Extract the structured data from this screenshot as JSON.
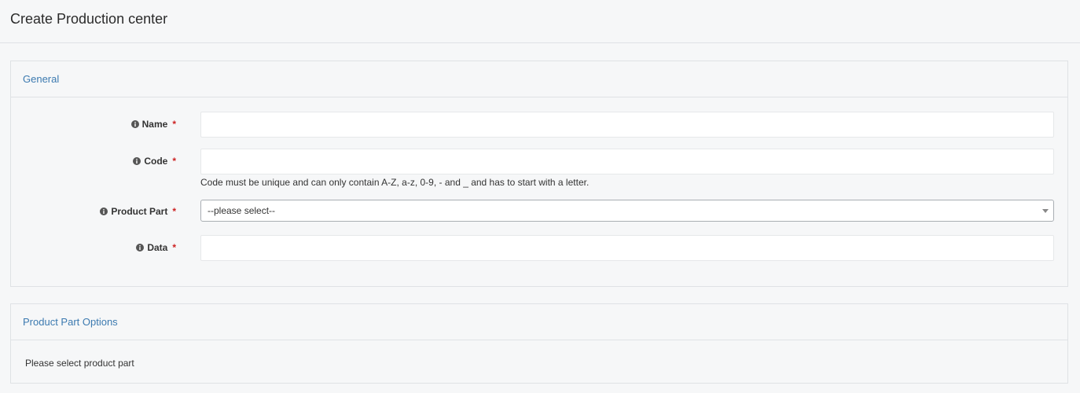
{
  "page": {
    "title": "Create Production center"
  },
  "general": {
    "heading": "General",
    "fields": {
      "name": {
        "label": "Name",
        "required": "*",
        "value": ""
      },
      "code": {
        "label": "Code",
        "required": "*",
        "value": "",
        "help": "Code must be unique and can only contain A-Z, a-z, 0-9, - and _ and has to start with a letter."
      },
      "product_part": {
        "label": "Product Part",
        "required": "*",
        "selected": "--please select--"
      },
      "data": {
        "label": "Data",
        "required": "*",
        "value": ""
      }
    }
  },
  "options": {
    "heading": "Product Part Options",
    "message": "Please select product part"
  },
  "colors": {
    "accent": "#3c7ab0",
    "required": "#cc2222",
    "background": "#f6f7f8",
    "border": "#dfe2e5"
  },
  "icons": {
    "info": "info-circle-icon",
    "dropdown": "caret-down-icon"
  }
}
